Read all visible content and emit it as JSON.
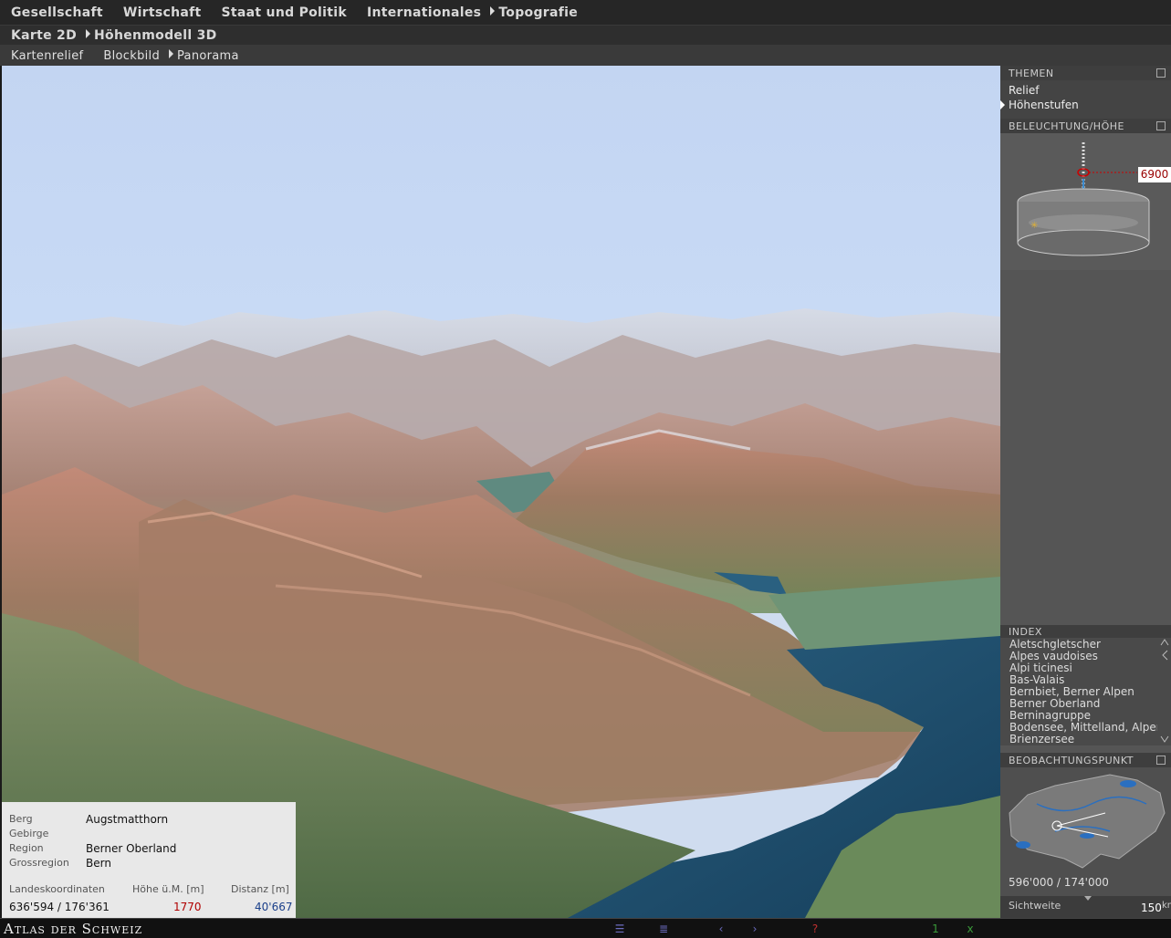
{
  "nav": {
    "level1": [
      "Gesellschaft",
      "Wirtschaft",
      "Staat und Politik",
      "Internationales",
      "Topografie"
    ],
    "level2": [
      "Karte 2D",
      "Höhenmodell 3D"
    ],
    "level3": [
      "Kartenrelief",
      "Blockbild",
      "Panorama"
    ]
  },
  "info": {
    "berg_label": "Berg",
    "berg_value": "Augstmatthorn",
    "gebirge_label": "Gebirge",
    "gebirge_value": "",
    "region_label": "Region",
    "region_value": "Berner Oberland",
    "grossregion_label": "Grossregion",
    "grossregion_value": "Bern",
    "coord_label": "Landeskoordinaten",
    "coord_value": "636'594 / 176'361",
    "hoehe_label": "Höhe ü.M. [m]",
    "hoehe_value": "1770",
    "distanz_label": "Distanz [m]",
    "distanz_value": "40'667"
  },
  "sidebar": {
    "themen_title": "THEMEN",
    "themes": [
      "Relief",
      "Höhenstufen"
    ],
    "beleuchtung_title": "BELEUCHTUNG/HÖHE",
    "height_value": "6900",
    "index_title": "INDEX",
    "index_items": [
      "Aletschgletscher",
      "Alpes vaudoises",
      "Alpi ticinesi",
      "Bas-Valais",
      "Bernbiet, Berner Alpen",
      "Berner Oberland",
      "Berninagruppe",
      "Bodensee, Mittelland, Alpen",
      "Brienzersee"
    ],
    "beobachtung_title": "BEOBACHTUNGSPUNKT",
    "observation_coord": "596'000 / 174'000",
    "sichtweite_label": "Sichtweite",
    "sichtweite_value": "150",
    "sichtweite_unit": "km"
  },
  "footer": {
    "brand": "Atlas der Schweiz"
  },
  "colors": {
    "sky": "#c8daf5",
    "lake": "#1e4d6b",
    "height_red": "#b00000",
    "distance_blue": "#1a3f8a"
  }
}
